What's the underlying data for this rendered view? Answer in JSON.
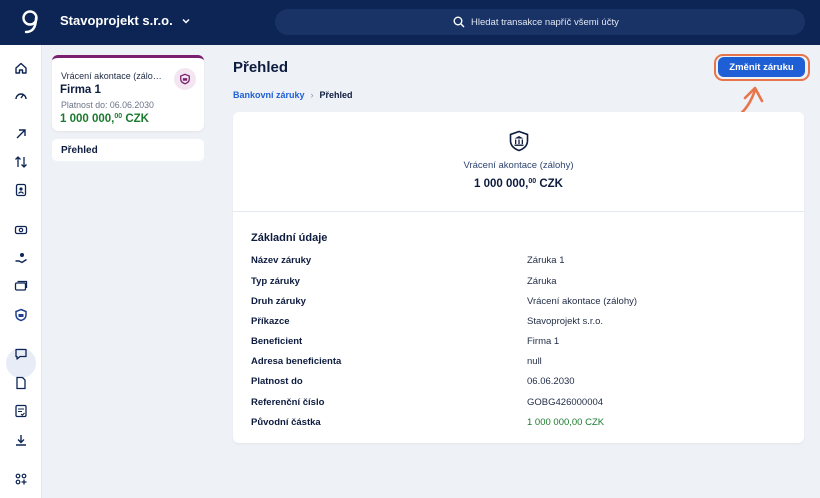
{
  "header": {
    "company": "Stavoprojekt s.r.o.",
    "search_placeholder": "Hledat transakce napříč všemi účty"
  },
  "sidebar_icons": [
    "home-icon",
    "gauge-icon",
    "arrow-up-right-icon",
    "transfer-icon",
    "contacts-icon",
    "money-icon",
    "hand-coin-icon",
    "cards-icon",
    "shield-bank-icon",
    "chat-icon",
    "document-icon",
    "checklist-icon",
    "download-icon",
    "apps-add-icon"
  ],
  "guarantee_card": {
    "subtitle": "Vrácení akontace (zálo…",
    "title": "Firma 1",
    "validity": "Platnost do: 06.06.2030",
    "amount_main": "1 000 000,",
    "amount_dec": "00",
    "amount_cur": " CZK"
  },
  "nav": {
    "overview": "Přehled"
  },
  "page": {
    "title": "Přehled",
    "change_button": "Změnit záruku",
    "breadcrumb": {
      "parent": "Bankovní záruky",
      "separator": "›",
      "current": "Přehled"
    }
  },
  "summary": {
    "type": "Vrácení akontace (zálohy)",
    "amount_main": "1 000 000,",
    "amount_dec": "00",
    "amount_cur": " CZK"
  },
  "details": {
    "title": "Základní údaje",
    "rows": [
      {
        "label": "Název záruky",
        "value": "Záruka 1"
      },
      {
        "label": "Typ záruky",
        "value": "Záruka"
      },
      {
        "label": "Druh záruky",
        "value": "Vrácení akontace (zálohy)"
      },
      {
        "label": "Příkazce",
        "value": "Stavoprojekt s.r.o."
      },
      {
        "label": "Beneficient",
        "value": "Firma 1"
      },
      {
        "label": "Adresa beneficienta",
        "value": "null"
      },
      {
        "label": "Platnost do",
        "value": "06.06.2030"
      },
      {
        "label": "Referenční číslo",
        "value": "GOBG426000004"
      },
      {
        "label": "Původní částka",
        "value": "1 000 000,00 CZK"
      }
    ]
  },
  "colors": {
    "brand_navy": "#0d2554",
    "accent_blue": "#1f5fd6",
    "highlight_orange": "#e8744a",
    "amount_green": "#1b7a2e",
    "guarantee_purple": "#7a1f6e"
  }
}
